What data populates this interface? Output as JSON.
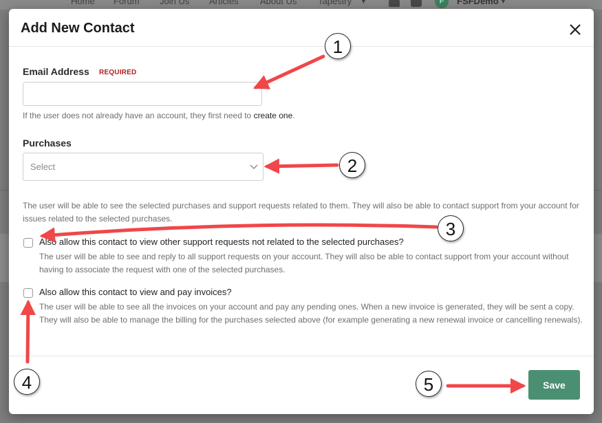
{
  "background_nav": {
    "items": [
      "Home",
      "Forum",
      "Join Us",
      "Articles",
      "About Us",
      "Tapestry"
    ],
    "avatar_initial": "F",
    "user_name": "FSFDemo"
  },
  "modal": {
    "title": "Add New Contact",
    "email": {
      "label": "Email Address",
      "required_tag": "REQUIRED",
      "value": "",
      "help_prefix": "If the user does not already have an account, they first need to",
      "help_link": "create one",
      "help_suffix": "."
    },
    "purchases": {
      "label": "Purchases",
      "placeholder": "Select",
      "help": "The user will be able to see the selected purchases and support requests related to them. They will also be able to contact support from your account for issues related to the selected purchases."
    },
    "option_support": {
      "label": "Also allow this contact to view other support requests not related to the selected purchases?",
      "checked": false,
      "help": "The user will be able to see and reply to all support requests on your account. They will also be able to contact support from your account without having to associate the request with one of the selected purchases."
    },
    "option_invoices": {
      "label": "Also allow this contact to view and pay invoices?",
      "checked": false,
      "help": "The user will be able to see all the invoices on your account and pay any pending ones. When a new invoice is generated, they will be sent a copy. They will also be able to manage the billing for the purchases selected above (for example generating a new renewal invoice or cancelling renewals)."
    },
    "save_label": "Save"
  },
  "annotations": {
    "badges": [
      "1",
      "2",
      "3",
      "4",
      "5"
    ],
    "arrow_color": "#f0474a"
  },
  "colors": {
    "primary_button": "#4a8f71",
    "required_text": "#b21d1d"
  }
}
